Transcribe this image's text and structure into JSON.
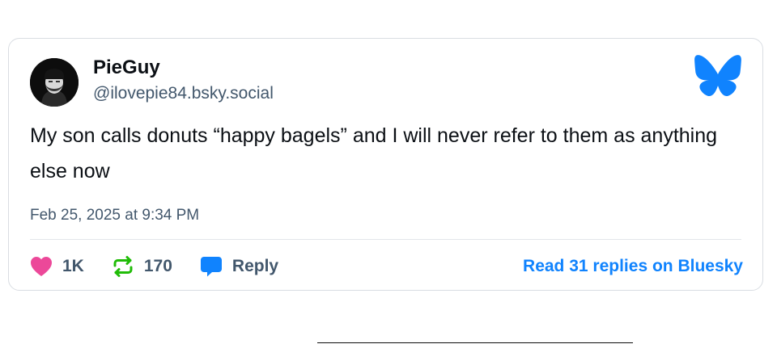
{
  "post": {
    "display_name": "PieGuy",
    "handle": "@ilovepie84.bsky.social",
    "text": "My son calls donuts “happy bagels” and I will never refer to them as anything else now",
    "timestamp": "Feb 25, 2025 at 9:34 PM"
  },
  "actions": {
    "likes": "1K",
    "reposts": "170",
    "reply_label": "Reply",
    "read_replies": "Read 31 replies on Bluesky"
  },
  "icons": {
    "logo": "bluesky-butterfly-icon",
    "like": "heart-icon",
    "repost": "repost-icon",
    "reply": "speech-bubble-icon"
  },
  "colors": {
    "brand_blue": "#1083fe",
    "like_pink": "#ec4899",
    "repost_green": "#20bc07",
    "secondary_text": "#42576c"
  }
}
